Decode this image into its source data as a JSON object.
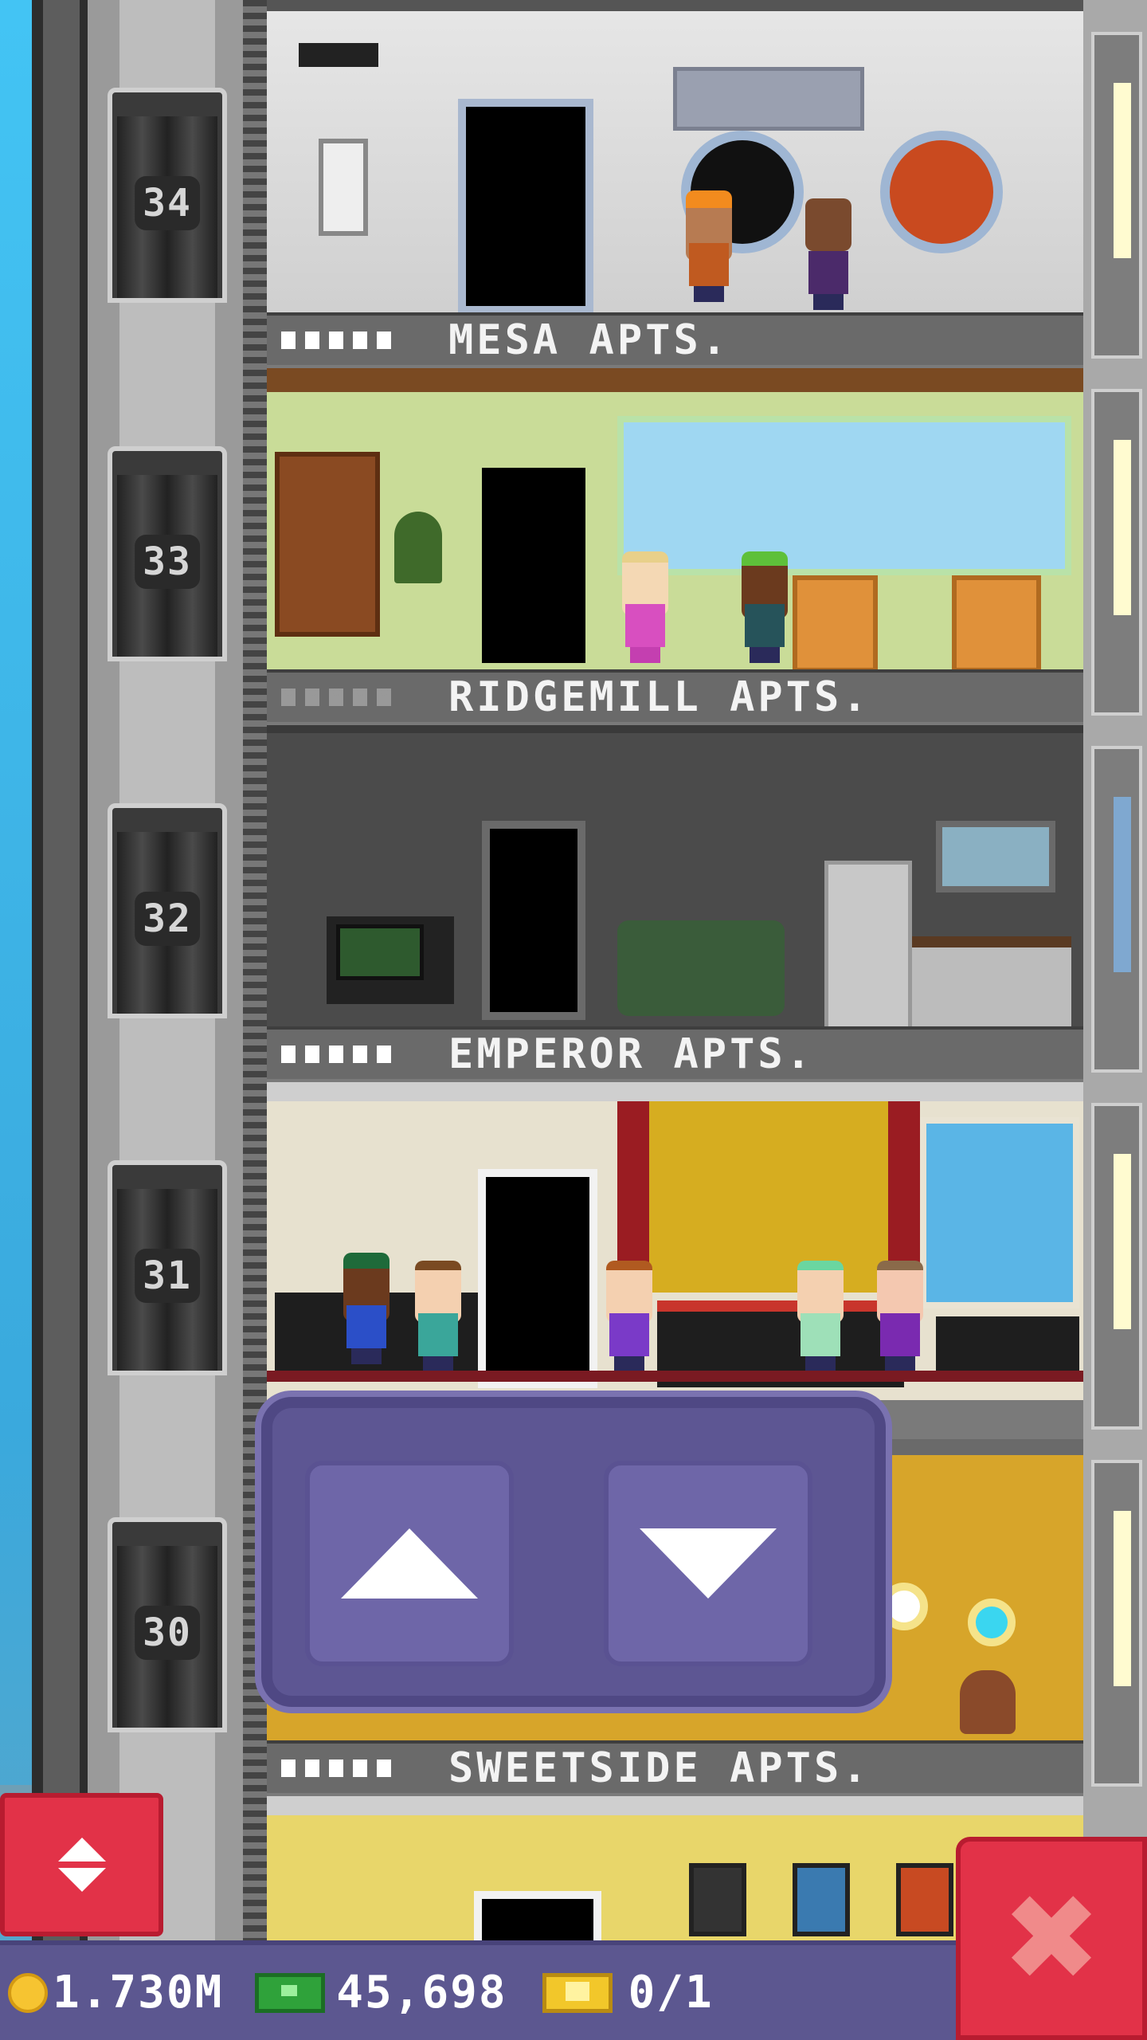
{
  "floors": [
    {
      "number": "34",
      "name": "MESA APTS."
    },
    {
      "number": "33",
      "name": "RIDGEMILL APTS."
    },
    {
      "number": "32",
      "name": "EMPEROR APTS."
    },
    {
      "number": "31",
      "name": ""
    },
    {
      "number": "30",
      "name": "SWEETSIDE APTS."
    }
  ],
  "status_bar": {
    "coins": "1.730M",
    "bux": "45,698",
    "tickets": "0/1"
  },
  "icons": {
    "elevator_toggle": "elevator-up-down-icon",
    "close": "close-x-icon",
    "up": "arrow-up-icon",
    "down": "arrow-down-icon",
    "coin": "coin-icon",
    "bux": "bux-icon",
    "ticket": "vip-ticket-icon"
  },
  "colors": {
    "control_pad": "#5d5693",
    "red_button": "#e23248",
    "status_bar": "#5c5790",
    "coin": "#f6c431",
    "bux": "#2fa23a"
  }
}
